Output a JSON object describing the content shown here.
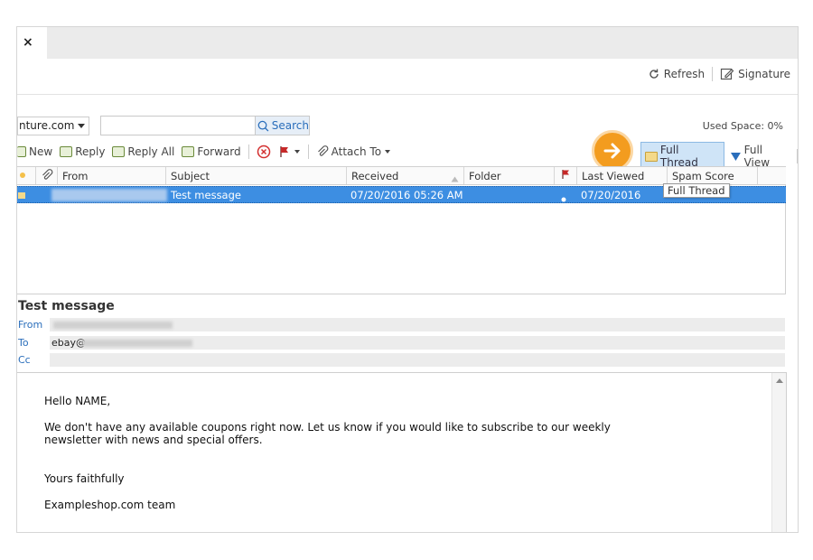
{
  "tab": {
    "close_label": "×"
  },
  "top_toolbar": {
    "refresh": "Refresh",
    "signature": "Signature"
  },
  "filter": {
    "domain_value": "nture.com",
    "search_value": "",
    "search_button": "Search",
    "used_space": "Used Space: 0%"
  },
  "actions": {
    "new": "New",
    "reply": "Reply",
    "reply_all": "Reply All",
    "forward": "Forward",
    "attach_to": "Attach To",
    "full_thread": "Full Thread",
    "full_view": "Full View"
  },
  "grid": {
    "columns": [
      "From",
      "Subject",
      "Received",
      "Folder",
      "Last Viewed",
      "Spam Score"
    ],
    "rows": [
      {
        "from": "",
        "subject": "Test message",
        "received": "07/20/2016 05:26 AM",
        "folder": "",
        "last_viewed": "07/20/2016",
        "spam_score": ""
      }
    ]
  },
  "tooltip": "Full Thread",
  "preview": {
    "title": "Test message",
    "from_label": "From",
    "to_label": "To",
    "cc_label": "Cc",
    "to_value": "ebay@"
  },
  "body": {
    "greeting": "Hello NAME,",
    "line1": "We don't have any available coupons right now. Let us know if you would like to subscribe to our weekly",
    "line2": "newsletter with news and special offers.",
    "closing": "Yours faithfully",
    "signature": "Exampleshop.com team"
  },
  "colors": {
    "accent": "#2a6ebb",
    "selection": "#3d8ee2",
    "highlight_button": "#f39c1f"
  }
}
